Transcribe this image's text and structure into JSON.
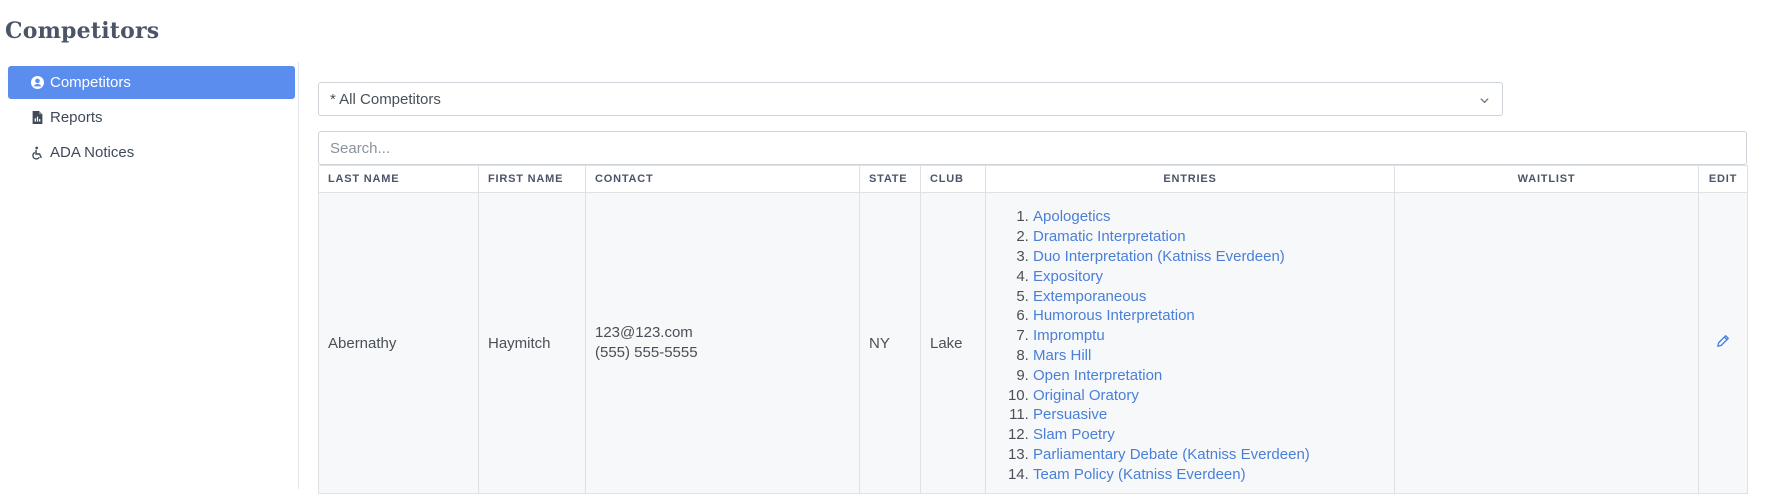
{
  "page": {
    "title": "Competitors"
  },
  "sidebar": {
    "items": [
      {
        "label": "Competitors",
        "icon": "user-circle-icon",
        "active": true
      },
      {
        "label": "Reports",
        "icon": "file-report-icon",
        "active": false
      },
      {
        "label": "ADA Notices",
        "icon": "wheelchair-icon",
        "active": false
      }
    ]
  },
  "filter": {
    "selected": "* All Competitors"
  },
  "search": {
    "placeholder": "Search..."
  },
  "table": {
    "headers": {
      "last_name": "LAST NAME",
      "first_name": "FIRST NAME",
      "contact": "CONTACT",
      "state": "STATE",
      "club": "CLUB",
      "entries": "ENTRIES",
      "waitlist": "WAITLIST",
      "edit": "EDIT"
    },
    "rows": [
      {
        "last_name": "Abernathy",
        "first_name": "Haymitch",
        "email": "123@123.com",
        "phone": "(555) 555-5555",
        "state": "NY",
        "club": "Lake",
        "entries": [
          "Apologetics",
          "Dramatic Interpretation",
          "Duo Interpretation (Katniss Everdeen)",
          "Expository",
          "Extemporaneous",
          "Humorous Interpretation",
          "Impromptu",
          "Mars Hill",
          "Open Interpretation",
          "Original Oratory",
          "Persuasive",
          "Slam Poetry",
          "Parliamentary Debate (Katniss Everdeen)",
          "Team Policy (Katniss Everdeen)"
        ],
        "waitlist": ""
      }
    ]
  },
  "colors": {
    "accent": "#5b8def",
    "link": "#4a7fd8",
    "title": "#4a5568"
  }
}
